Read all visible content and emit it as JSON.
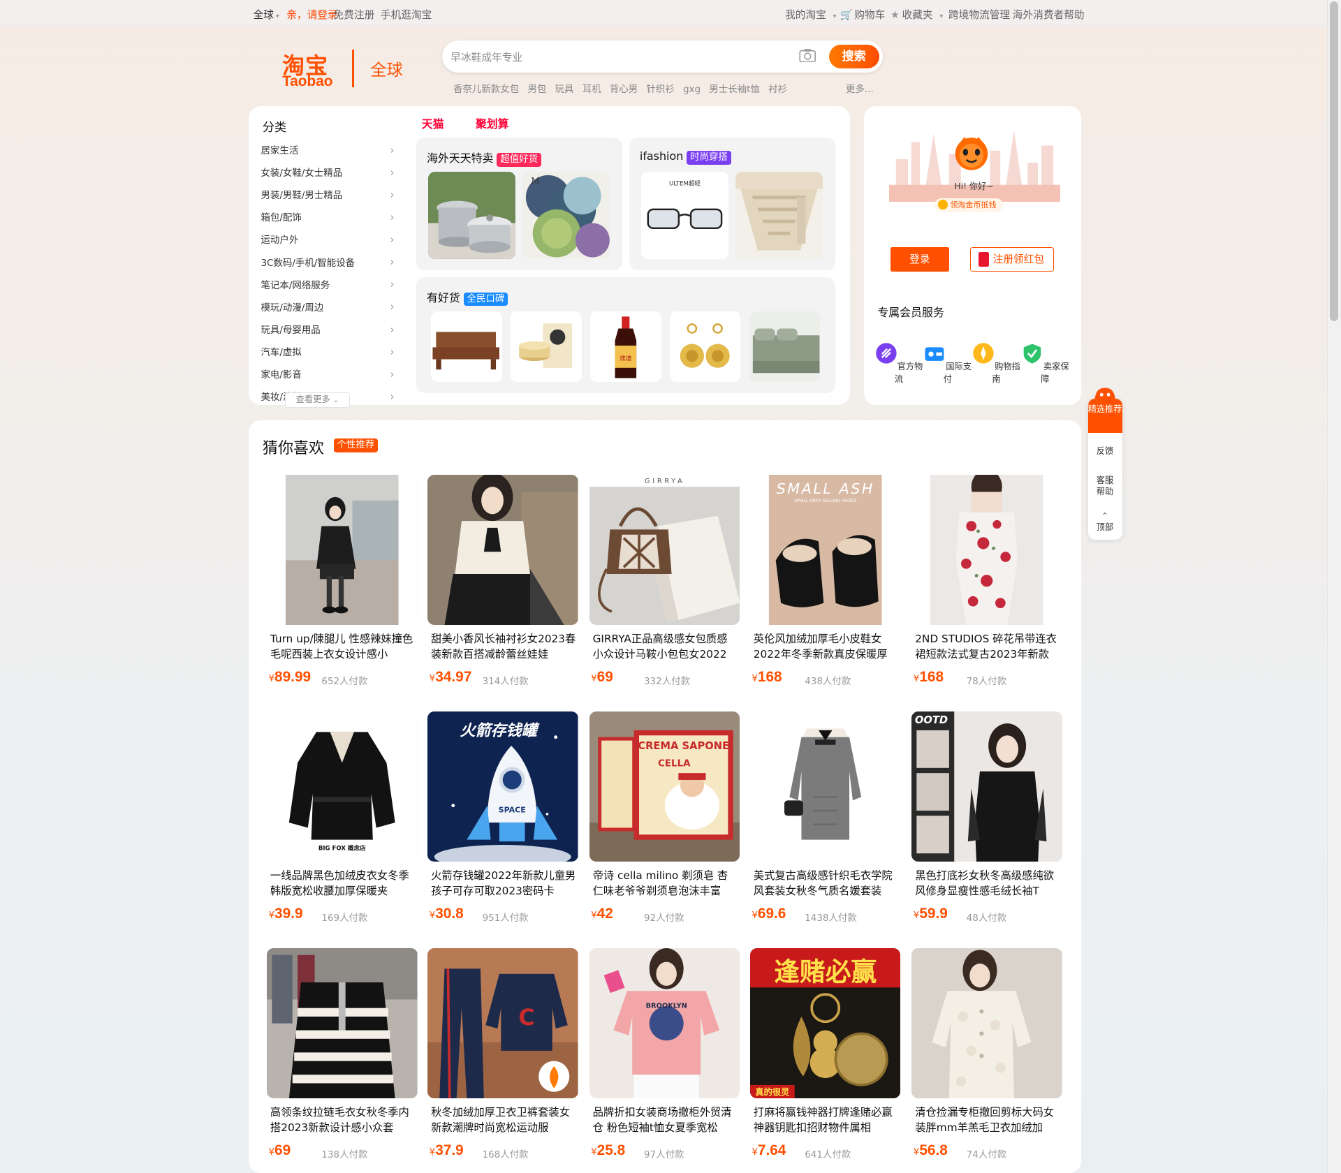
{
  "topbar": {
    "region": "全球",
    "greeting": "亲，请登录",
    "register": "免费注册",
    "mobile": "手机逛淘宝",
    "my_taobao": "我的淘宝",
    "cart": "购物车",
    "favorites": "收藏夹",
    "logistics": "跨境物流管理",
    "help": "海外消费者帮助"
  },
  "logo": {
    "cn": "淘宝",
    "en": "Taobao",
    "region": "全球"
  },
  "search": {
    "placeholder": "早冰鞋成年专业",
    "button": "搜索",
    "hot_words": [
      "香奈儿新款女包",
      "男包",
      "玩具",
      "耳机",
      "背心男",
      "针织衫",
      "gxg",
      "男士长袖t恤",
      "衬衫"
    ],
    "more": "更多..."
  },
  "category": {
    "title": "分类",
    "items": [
      "居家生活",
      "女装/女鞋/女士精品",
      "男装/男鞋/男士精品",
      "箱包/配饰",
      "运动户外",
      "3C数码/手机/智能设备",
      "笔记本/网络服务",
      "模玩/动漫/周边",
      "玩具/母婴用品",
      "汽车/虚拟",
      "家电/影音",
      "美妆/洗护"
    ],
    "see_more": "查看更多"
  },
  "channels": {
    "tmall": "天猫",
    "juhuasuan": "聚划算"
  },
  "panels": {
    "overseas": {
      "title": "海外天天特卖",
      "tag": "超值好货"
    },
    "ifashion": {
      "title": "ifashion",
      "tag": "时尚穿搭"
    },
    "goods": {
      "title": "有好货",
      "tag": "全民口碑"
    }
  },
  "user": {
    "hi": "Hi! 你好~",
    "coin": "领淘金币抵钱",
    "login": "登录",
    "register": "注册领红包",
    "member_title": "专属会员服务",
    "services": [
      "官方物流",
      "国际支付",
      "购物指南",
      "卖家保障"
    ]
  },
  "floatbar": {
    "recommend": "精选推荐",
    "feedback": "反馈",
    "service": "客服帮助",
    "top": "顶部"
  },
  "guess": {
    "title": "猜你喜欢",
    "tag": "个性推荐"
  },
  "products": [
    {
      "name": "Turn up/陳腿儿 性感辣妹撞色毛呢西装上衣女设计感小",
      "price": "89.99",
      "sold": "652人付款"
    },
    {
      "name": "甜美小香风长袖衬衫女2023春装新款百搭减龄蕾丝娃娃",
      "price": "34.97",
      "sold": "314人付款"
    },
    {
      "name": "GIRRYA正品高级感女包质感小众设计马鞍小包包女2022",
      "price": "69",
      "sold": "332人付款"
    },
    {
      "name": "英伦风加绒加厚毛小皮鞋女2022年冬季新款真皮保暖厚",
      "price": "168",
      "sold": "438人付款"
    },
    {
      "name": "2ND STUDIOS 碎花吊带连衣裙短款法式复古2023年新款",
      "price": "168",
      "sold": "78人付款"
    },
    {
      "name": "一线品牌黑色加绒皮衣女冬季韩版宽松收腰加厚保暖夹",
      "price": "39.9",
      "sold": "169人付款"
    },
    {
      "name": "火箭存钱罐2022年新款儿童男孩子可存可取2023密码卡",
      "price": "30.8",
      "sold": "951人付款"
    },
    {
      "name": "帝诗 cella milino 剃须皂 杏仁味老爷爷剃须皂泡沫丰富",
      "price": "42",
      "sold": "92人付款"
    },
    {
      "name": "美式复古高级感针织毛衣学院风套装女秋冬气质名媛套装",
      "price": "69.6",
      "sold": "1438人付款"
    },
    {
      "name": "黑色打底衫女秋冬高级感纯欲风修身显瘦性感毛绒长袖T",
      "price": "59.9",
      "sold": "48人付款"
    },
    {
      "name": "高领条纹拉链毛衣女秋冬季内搭2023新款设计感小众套",
      "price": "69",
      "sold": "138人付款"
    },
    {
      "name": "秋冬加绒加厚卫衣卫裤套装女新款潮牌时尚宽松运动服",
      "price": "37.9",
      "sold": "168人付款"
    },
    {
      "name": "品牌折扣女装商场撤柜外贸清仓 粉色短袖t恤女夏季宽松",
      "price": "25.8",
      "sold": "97人付款"
    },
    {
      "name": "打麻将赢钱神器打牌逢赌必赢神器钥匙扣招财物件属相",
      "price": "7.64",
      "sold": "641人付款"
    },
    {
      "name": "清仓捡漏专柜撤回剪标大码女装胖mm羊羔毛卫衣加绒加",
      "price": "56.8",
      "sold": "74人付款"
    }
  ],
  "product_image_text": {
    "bag_brand": "GIRRYA",
    "shoe_brand": "SMALL ASH",
    "shoe_sub": "SMALL GREY SELLING SHOES",
    "jacket_brand": "BIG FOX 概念店",
    "rocket_title": "火箭存钱罐",
    "rocket_label": "SPACE",
    "soap_brand": "CELLA",
    "soap_title": "CREMA SAPONE",
    "ootd": "OOTD",
    "keychain_title": "逢赌必赢",
    "keychain_badge": "真的很灵",
    "shirt_print": "BROOKLYN",
    "glasses_brand": "ULTEM超轻",
    "goods_label": "炫迪"
  },
  "colors": {
    "brand": "#ff5000",
    "tmall": "#ff0036",
    "tag_orange": "#ff5000",
    "tag_purple": "#7b3ff2",
    "tag_blue": "#1a8cff"
  }
}
